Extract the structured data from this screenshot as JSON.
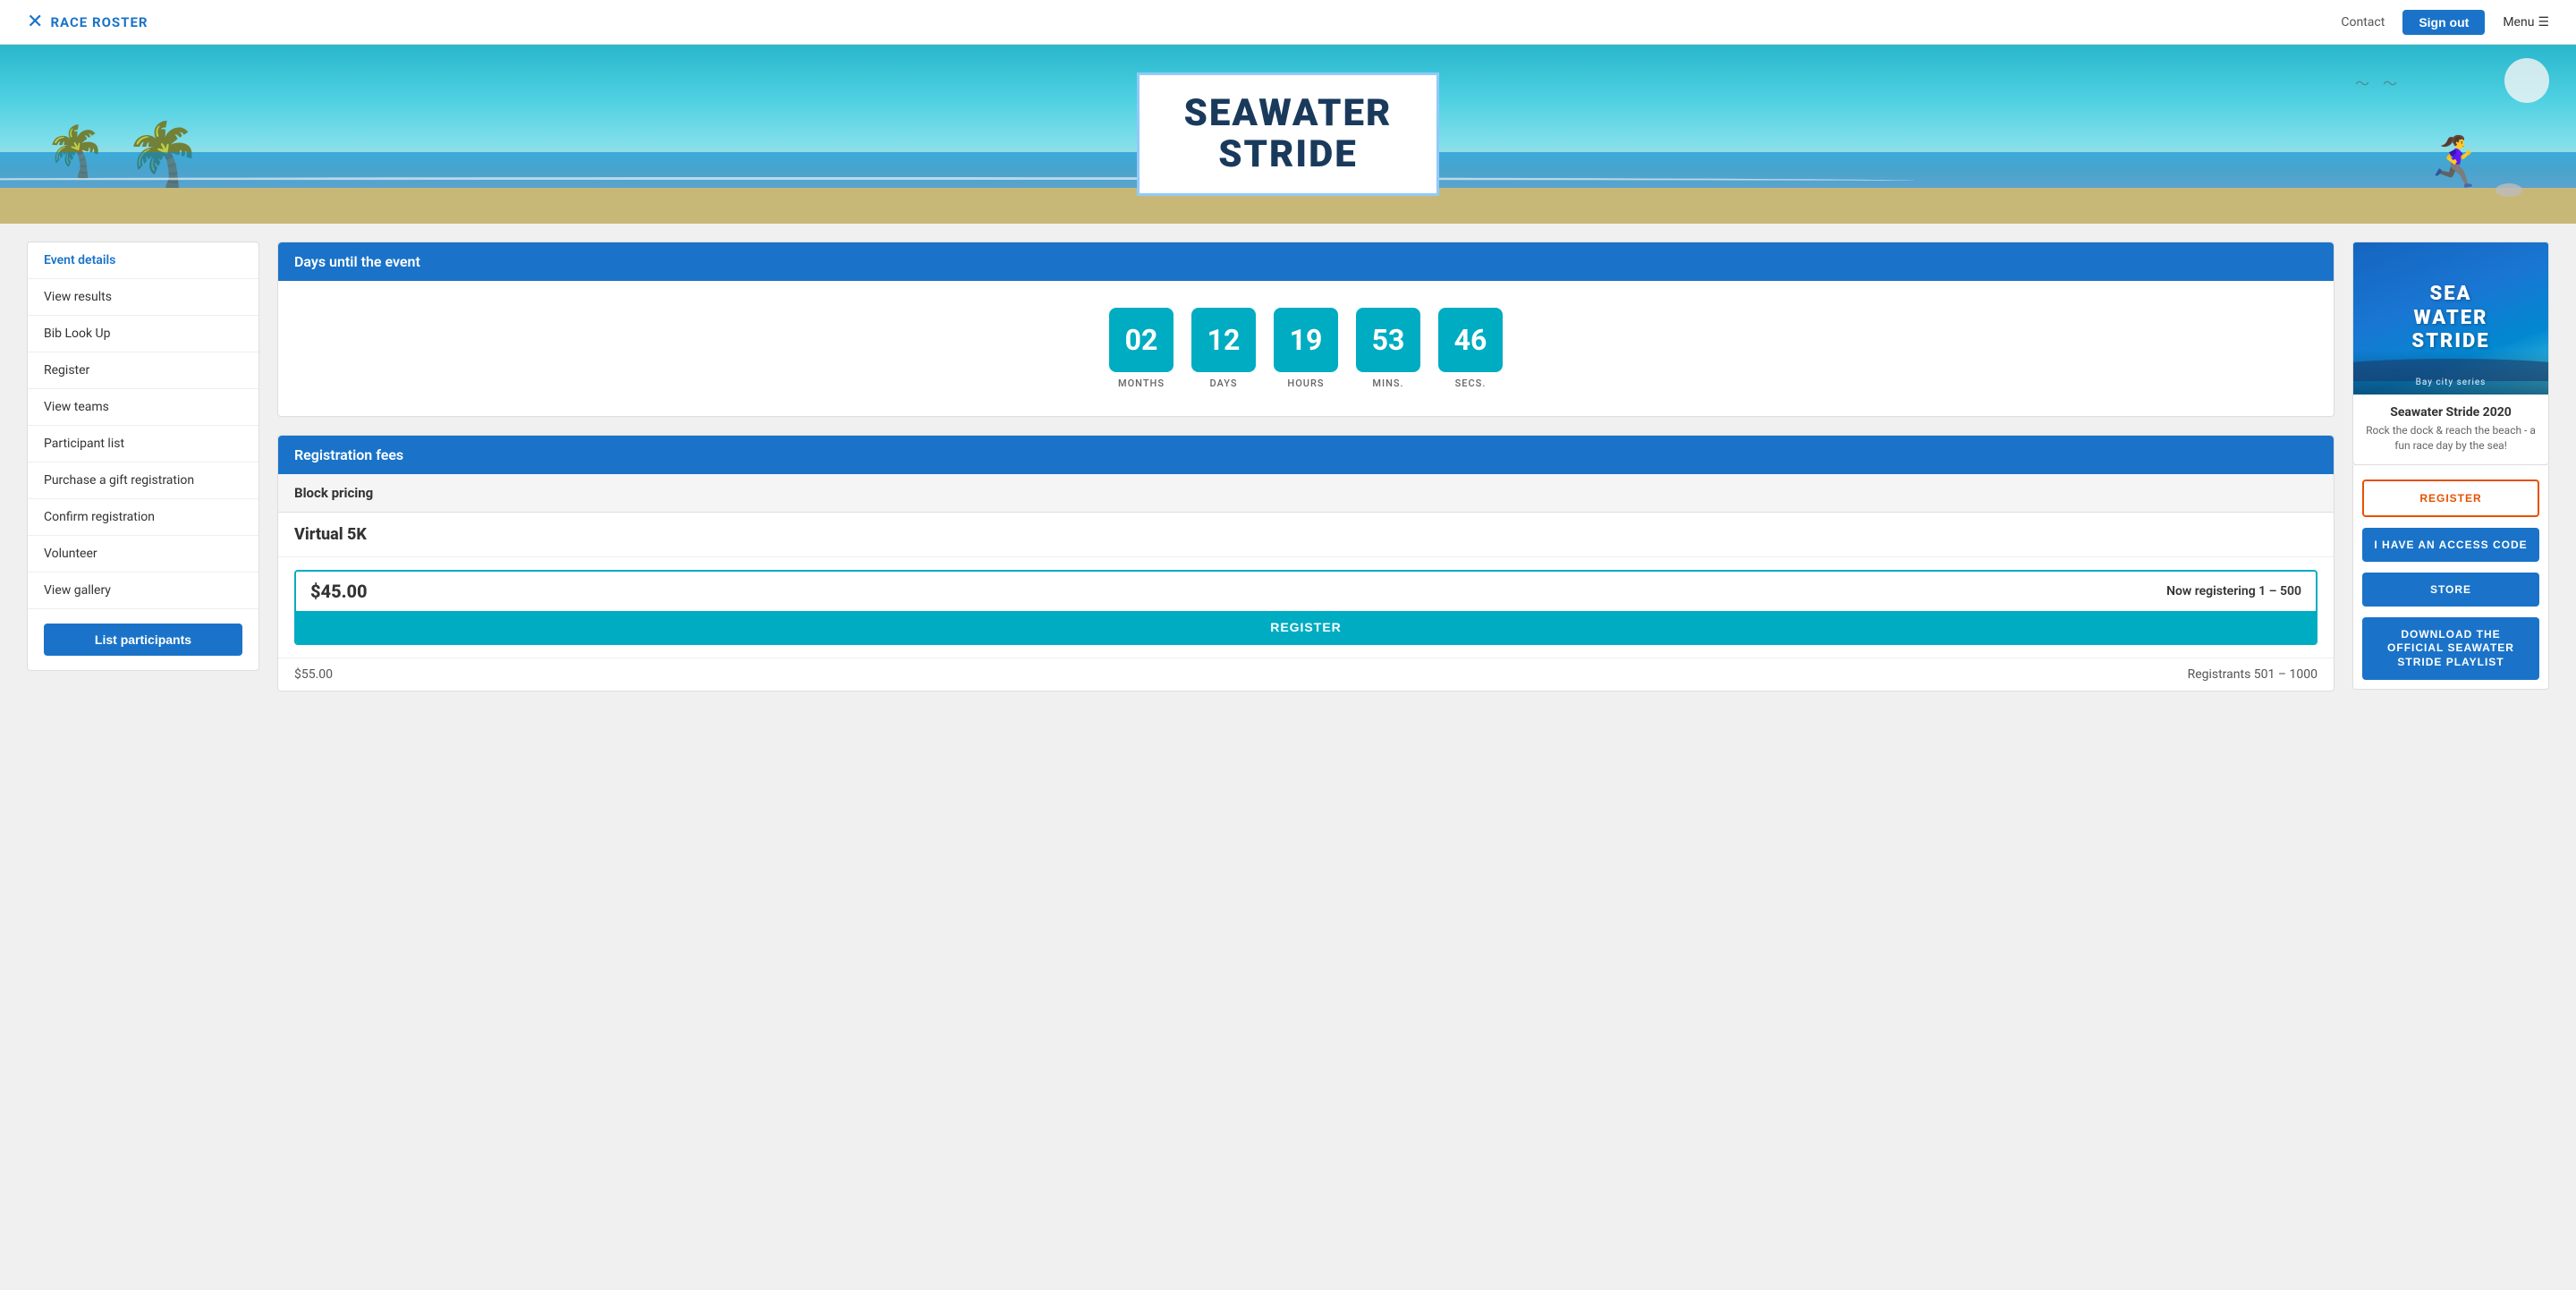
{
  "navbar": {
    "logo_text": "RACE ROSTER",
    "contact_label": "Contact",
    "signout_label": "Sign out",
    "menu_label": "Menu"
  },
  "hero": {
    "title_line1": "SEAWATER",
    "title_line2": "STRIDE"
  },
  "sidebar": {
    "items": [
      {
        "label": "Event details",
        "active": true
      },
      {
        "label": "View results",
        "active": false
      },
      {
        "label": "Bib Look Up",
        "active": false
      },
      {
        "label": "Register",
        "active": false
      },
      {
        "label": "View teams",
        "active": false
      },
      {
        "label": "Participant list",
        "active": false
      },
      {
        "label": "Purchase a gift registration",
        "active": false
      },
      {
        "label": "Confirm registration",
        "active": false
      },
      {
        "label": "Volunteer",
        "active": false
      },
      {
        "label": "View gallery",
        "active": false
      }
    ],
    "list_participants_btn": "List participants"
  },
  "countdown": {
    "section_title": "Days until the event",
    "units": [
      {
        "value": "02",
        "label": "MONTHS"
      },
      {
        "value": "12",
        "label": "DAYS"
      },
      {
        "value": "19",
        "label": "HOURS"
      },
      {
        "value": "53",
        "label": "MINS."
      },
      {
        "value": "46",
        "label": "SECS."
      }
    ]
  },
  "fees": {
    "section_title": "Registration fees",
    "block_pricing_label": "Block pricing",
    "event_name": "Virtual 5K",
    "price_main": "$45.00",
    "price_range": "Now registering 1 – 500",
    "register_btn": "REGISTER",
    "price_lower": "$55.00",
    "registrants_lower": "Registrants 501 – 1000"
  },
  "right_sidebar": {
    "poster": {
      "line1": "SEA",
      "line2": "WATER",
      "line3": "STRIDE",
      "subtitle": "Bay city series"
    },
    "event_name": "Seawater Stride 2020",
    "event_desc": "Rock the dock & reach the beach - a fun race day by the sea!",
    "register_btn": "REGISTER",
    "access_code_btn": "I HAVE AN ACCESS CODE",
    "store_btn": "STORE",
    "playlist_btn": "DOWNLOAD THE OFFICIAL SEAWATER STRIDE PLAYLIST"
  }
}
